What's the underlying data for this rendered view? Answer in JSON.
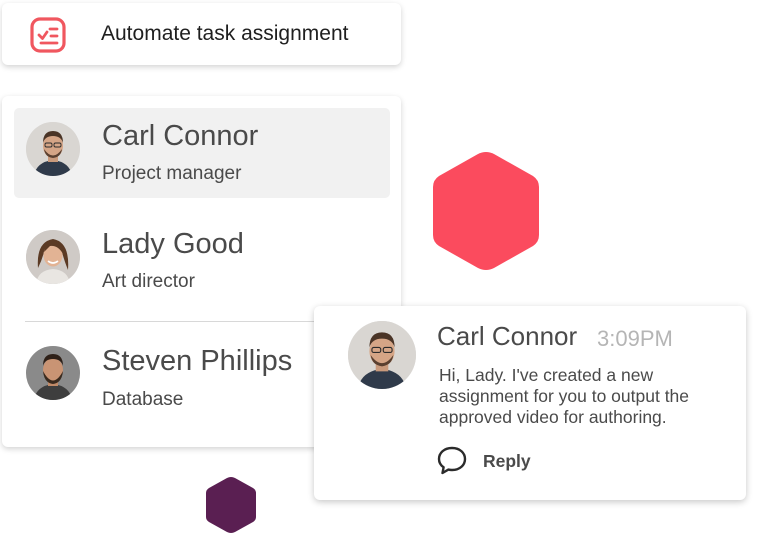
{
  "task_card": {
    "label": "Automate task assignment",
    "icon": "checklist-icon",
    "icon_color": "#f0575f"
  },
  "people": [
    {
      "name": "Carl Connor",
      "role": "Project manager",
      "selected": true
    },
    {
      "name": "Lady Good",
      "role": "Art director",
      "selected": false
    },
    {
      "name": "Steven Phillips",
      "role": "Database",
      "selected": false
    }
  ],
  "message": {
    "author": "Carl Connor",
    "time": "3:09PM",
    "body": "Hi, Lady. I've created a new assignment for you to output the approved video for authoring.",
    "reply_label": "Reply",
    "reply_icon": "speech-bubble-icon"
  },
  "colors": {
    "hex_red": "#fb4b5e",
    "hex_purple": "#5a1f52",
    "selected_row_bg": "#f1f1f1"
  }
}
